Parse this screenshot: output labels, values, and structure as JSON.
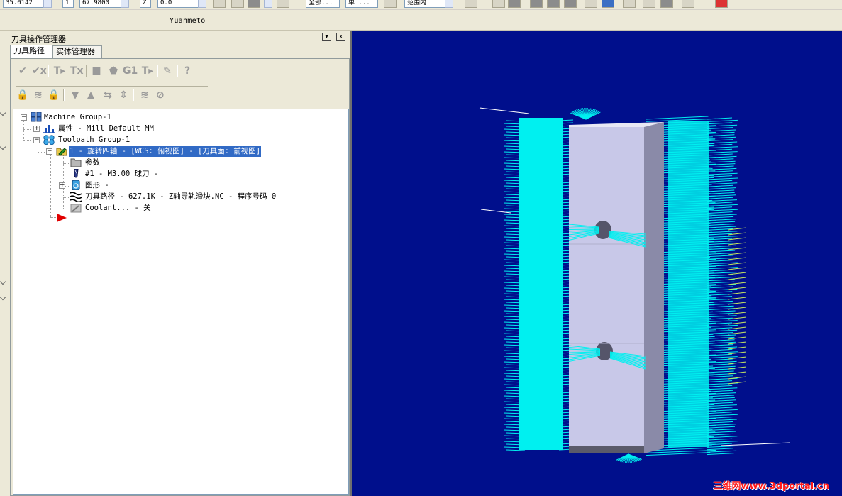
{
  "toolbar": {
    "field_1": "35.0142",
    "field_2": "1",
    "field_3": "67.9800",
    "field_4": "Z",
    "field_5": "0.0",
    "field_6": "全部...",
    "field_7": "单 ...",
    "field_8": "范围内"
  },
  "app_title": "Yuanmeto",
  "manager": {
    "title": "刀具操作管理器",
    "dropdown_glyph": "▾",
    "close_glyph": "x",
    "tabs": [
      {
        "label": "刀具路径"
      },
      {
        "label": "实体管理器"
      }
    ],
    "toolbar_row1": [
      "✔",
      "✔x",
      "T▸",
      "Tx",
      "■",
      "⬟",
      "G1",
      "T▸",
      "✎",
      "?"
    ],
    "toolbar_row2": [
      "🔒",
      "≋",
      "🔒",
      "▼",
      "▲",
      "⇆",
      "⇕",
      "≋",
      "⊘"
    ]
  },
  "tree": {
    "machine_group": "Machine Group-1",
    "properties": "属性 - Mill Default MM",
    "toolpath_group": "Toolpath Group-1",
    "operation": "1 - 旋转四轴 - [WCS: 俯视图] - [刀具面: 前视图]",
    "params": "参数",
    "tool": "#1 - M3.00 球刀 -",
    "geometry": "图形 -",
    "toolpath": "刀具路径 - 627.1K - Z轴导轨滑块.NC - 程序号码 0",
    "coolant": "Coolant... - 关"
  },
  "watermark": "三维网www.3dportal.cn",
  "colors": {
    "viewport_bg": "#000f8c",
    "toolpath": "#00f0f0",
    "part": "#c8c8e8",
    "selection": "#316ac5",
    "watermark": "#ff1a1a"
  }
}
